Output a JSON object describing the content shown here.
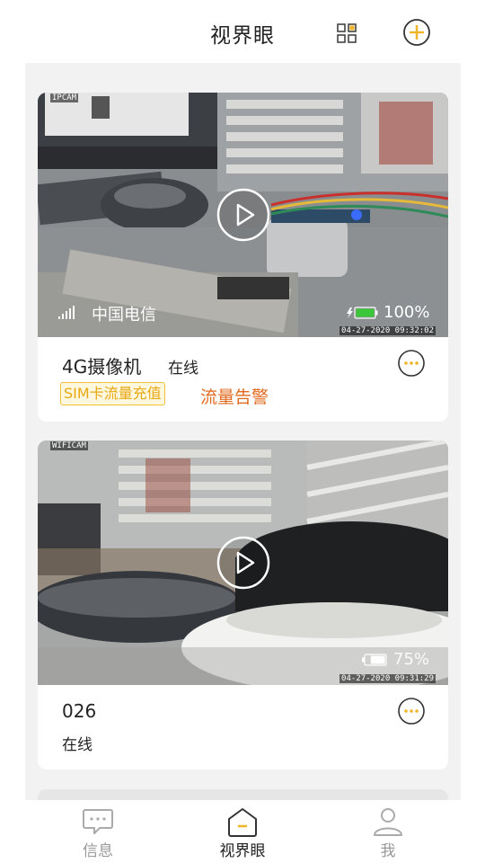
{
  "header": {
    "title": "视界眼",
    "grid_icon": "grid-view-icon",
    "add_icon": "add-circle-icon",
    "accent_color": "#f0b429"
  },
  "devices": [
    {
      "osd_name": "IPCAM",
      "osd_time": "04-27-2020 09:32:02",
      "carrier": "中国电信",
      "battery": "100%",
      "battery_level": 1.0,
      "name": "4G摄像机",
      "status": "在线",
      "sim_button": "SIM卡流量充值",
      "alert_link": "流量告警"
    },
    {
      "osd_name": "WIFICAM",
      "osd_time": "04-27-2020 09:31:29",
      "battery": "75%",
      "battery_level": 0.75,
      "name": "026",
      "status": "在线"
    }
  ],
  "tabbar": {
    "tabs": [
      {
        "label": "信息",
        "icon": "message-icon",
        "active": false
      },
      {
        "label": "视界眼",
        "icon": "home-icon",
        "active": true
      },
      {
        "label": "我",
        "icon": "user-icon",
        "active": false
      }
    ]
  }
}
